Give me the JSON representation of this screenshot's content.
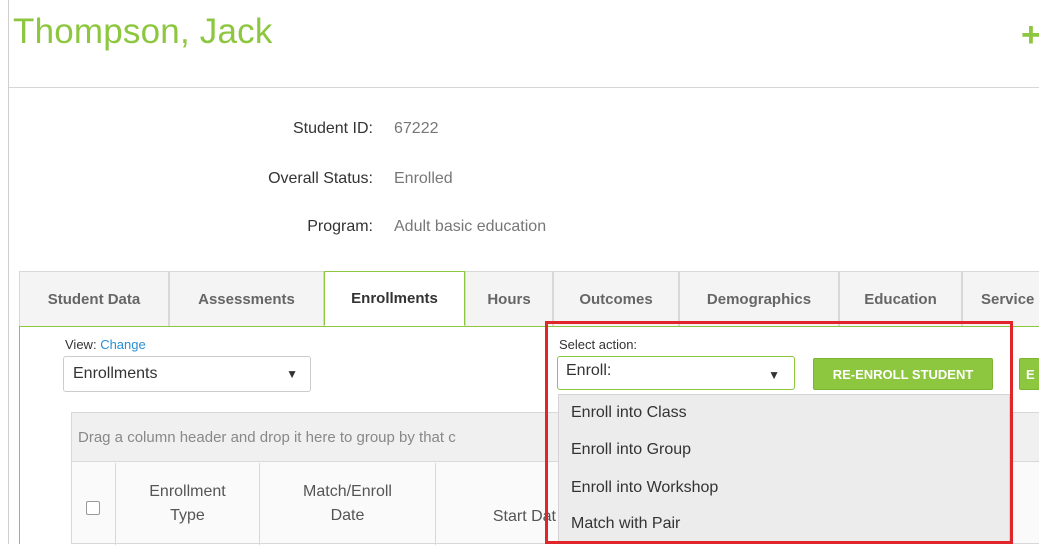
{
  "header": {
    "student_name": "Thompson, Jack",
    "add_symbol": "+"
  },
  "info": {
    "student_id_label": "Student ID:",
    "student_id_value": "67222",
    "status_label": "Overall Status:",
    "status_value": "Enrolled",
    "program_label": "Program:",
    "program_value": "Adult basic education"
  },
  "tabs": [
    {
      "label": "Student Data"
    },
    {
      "label": "Assessments"
    },
    {
      "label": "Enrollments",
      "active": true
    },
    {
      "label": "Hours"
    },
    {
      "label": "Outcomes"
    },
    {
      "label": "Demographics"
    },
    {
      "label": "Education"
    },
    {
      "label": "Service"
    }
  ],
  "view": {
    "label": "View:",
    "change_link": "Change",
    "selected": "Enrollments"
  },
  "action": {
    "label": "Select action:",
    "selected": "Enroll:",
    "reenroll_button": "RE-ENROLL STUDENT",
    "next_button_partial": "E",
    "options": [
      "Enroll into Class",
      "Enroll into Group",
      "Enroll into Workshop",
      "Match with Pair"
    ]
  },
  "grid": {
    "group_hint": "Drag a column header and drop it here to group by that c",
    "columns": [
      {
        "line1": "Enrollment",
        "line2": "Type"
      },
      {
        "line1": "Match/Enroll",
        "line2": "Date"
      },
      {
        "line1": "Start Dat",
        "line2": ""
      }
    ]
  },
  "colors": {
    "accent": "#8dc63f",
    "highlight": "#e0262a",
    "link": "#2a8fd6"
  }
}
